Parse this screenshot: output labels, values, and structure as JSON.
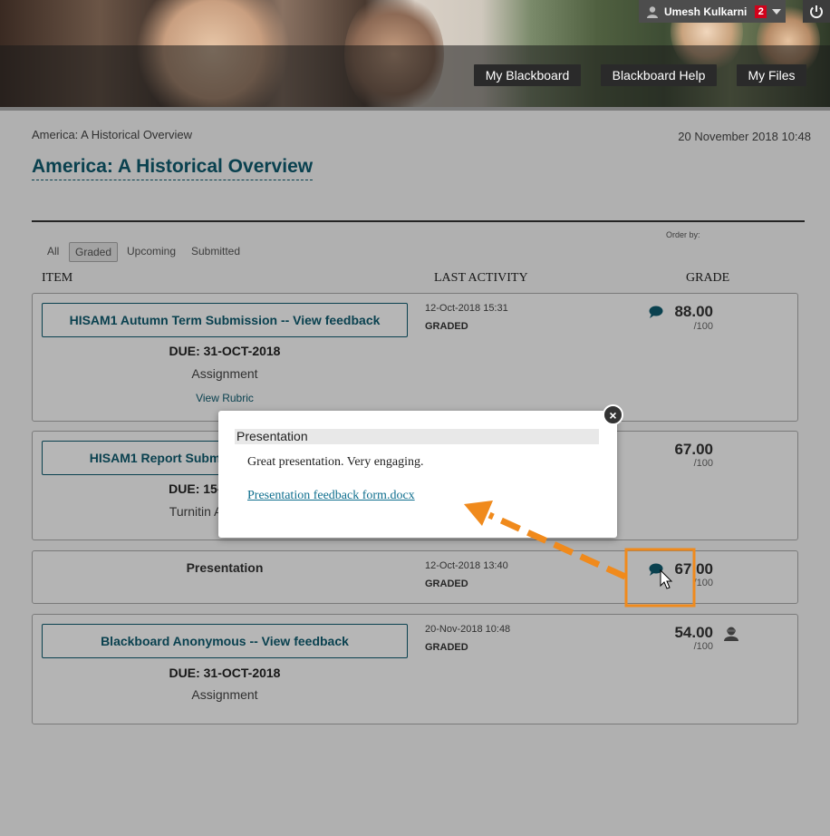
{
  "header": {
    "user_name": "Umesh Kulkarni",
    "notification_count": "2",
    "nav": [
      "My Blackboard",
      "Blackboard Help",
      "My Files"
    ]
  },
  "breadcrumb": "America: A Historical Overview",
  "date": "20 November 2018 10:48",
  "course_title": "America: A Historical Overview",
  "filters": {
    "items": [
      "All",
      "Graded",
      "Upcoming",
      "Submitted"
    ],
    "active": "Graded",
    "order_by_label": "Order by:"
  },
  "columns": {
    "item": "ITEM",
    "last_activity": "LAST ACTIVITY",
    "grade": "GRADE"
  },
  "items": [
    {
      "title": "HISAM1 Autumn Term Submission -- View feedback",
      "due": "DUE: 31-OCT-2018",
      "type": "Assignment",
      "rubric": "View Rubric",
      "activity_date": "12-Oct-2018 15:31",
      "status": "GRADED",
      "grade": "88.00",
      "out_of": "/100"
    },
    {
      "title": "HISAM1 Report Submission -- View feedback",
      "due": "DUE: 15-NOV-2018",
      "type": "Turnitin Assignment",
      "grade": "67.00",
      "out_of": "/100"
    },
    {
      "title": "Presentation",
      "activity_date": "12-Oct-2018 13:40",
      "status": "GRADED",
      "grade": "67.00",
      "out_of": "/100"
    },
    {
      "title": "Blackboard Anonymous -- View feedback",
      "due": "DUE: 31-OCT-2018",
      "type": "Assignment",
      "activity_date": "20-Nov-2018 10:48",
      "status": "GRADED",
      "grade": "54.00",
      "out_of": "/100"
    }
  ],
  "popup": {
    "title": "Presentation",
    "text": "Great presentation. Very engaging.",
    "link": "Presentation feedback form.docx"
  },
  "colors": {
    "accent": "#0e5a6e",
    "annotation": "#f08a1c",
    "badge": "#d0021b"
  }
}
